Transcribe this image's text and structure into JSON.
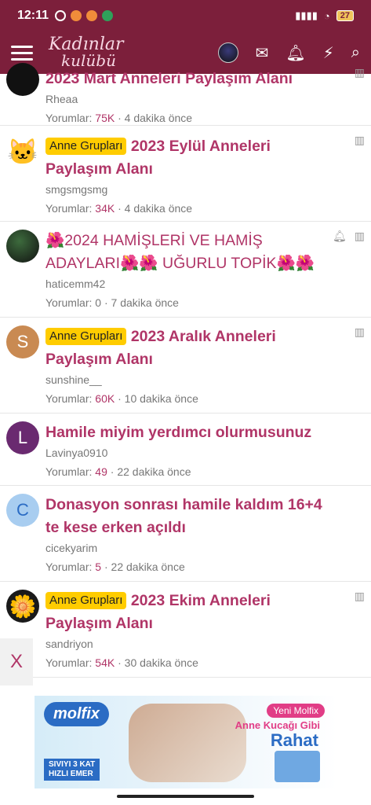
{
  "status": {
    "time": "12:11",
    "battery": "27"
  },
  "app": {
    "logo_line1": "Kadınlar",
    "logo_line2": "kulübü"
  },
  "topics": [
    {
      "title": "2023 Mart Anneleri Paylaşım Alanı",
      "badge": "",
      "author": "Rheaa",
      "replies_label": "Yorumlar:",
      "replies": "75K",
      "time": "4 dakika önce",
      "avatar_letter": "",
      "avatar_color": "#111111"
    },
    {
      "title": "2023 Eylül Anneleri Paylaşım Alanı",
      "badge": "Anne Grupları",
      "author": "smgsmgsmg",
      "replies_label": "Yorumlar:",
      "replies": "34K",
      "time": "4 dakika önce",
      "avatar_letter": "🐱",
      "avatar_color": "#ffffff"
    },
    {
      "title": "🌺2024 HAMİŞLERİ VE HAMİŞ ADAYLARI🌺🌺 UĞURLU TOPİK🌺🌺",
      "badge": "",
      "author": "haticemm42",
      "replies_label": "Yorumlar:",
      "replies": "0",
      "time": "7 dakika önce",
      "avatar_letter": "",
      "avatar_color": "#2a2a2a"
    },
    {
      "title": "2023 Aralık Anneleri Paylaşım Alanı",
      "badge": "Anne Grupları",
      "author": "sunshine__",
      "replies_label": "Yorumlar:",
      "replies": "60K",
      "time": "10 dakika önce",
      "avatar_letter": "S",
      "avatar_color": "#c98a52"
    },
    {
      "title": "Hamile miyim yerdımcı olurmusunuz",
      "badge": "",
      "author": "Lavinya0910",
      "replies_label": "Yorumlar:",
      "replies": "49",
      "time": "22 dakika önce",
      "avatar_letter": "L",
      "avatar_color": "#6a2a70"
    },
    {
      "title": "Donasyon sonrası hamile kaldım 16+4 te kese erken açıldı",
      "badge": "",
      "author": "cicekyarim",
      "replies_label": "Yorumlar:",
      "replies": "5",
      "time": "22 dakika önce",
      "avatar_letter": "C",
      "avatar_color": "#a8cdf0"
    },
    {
      "title": "2023 Ekim Anneleri Paylaşım Alanı",
      "badge": "Anne Grupları",
      "author": "sandriyon",
      "replies_label": "Yorumlar:",
      "replies": "54K",
      "time": "30 dakika önce",
      "avatar_letter": "🌼",
      "avatar_color": "#1a1a1a"
    }
  ],
  "ad": {
    "close_label": "X",
    "brand": "molfix",
    "tag": "Yeni Molfix",
    "slogan1": "Anne Kucağı Gibi",
    "slogan2": "Rahat",
    "bottom_line1": "SIVIYI 3 KAT",
    "bottom_line2": "HIZLI EMER"
  },
  "colors": {
    "brand": "#7c1f3b",
    "title": "#b03567",
    "badge": "#ffcc00"
  }
}
